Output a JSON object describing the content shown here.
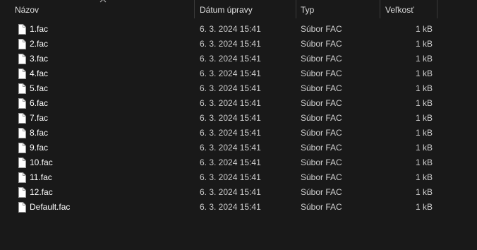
{
  "columns": {
    "name": "Názov",
    "date": "Dátum úpravy",
    "type": "Typ",
    "size": "Veľkosť"
  },
  "sort": {
    "column": "name",
    "icon": "chevron-up-icon"
  },
  "files": [
    {
      "name": "1.fac",
      "date": "6. 3. 2024 15:41",
      "type": "Súbor FAC",
      "size": "1 kB",
      "icon": "file-icon"
    },
    {
      "name": "2.fac",
      "date": "6. 3. 2024 15:41",
      "type": "Súbor FAC",
      "size": "1 kB",
      "icon": "file-icon"
    },
    {
      "name": "3.fac",
      "date": "6. 3. 2024 15:41",
      "type": "Súbor FAC",
      "size": "1 kB",
      "icon": "file-icon"
    },
    {
      "name": "4.fac",
      "date": "6. 3. 2024 15:41",
      "type": "Súbor FAC",
      "size": "1 kB",
      "icon": "file-icon"
    },
    {
      "name": "5.fac",
      "date": "6. 3. 2024 15:41",
      "type": "Súbor FAC",
      "size": "1 kB",
      "icon": "file-icon"
    },
    {
      "name": "6.fac",
      "date": "6. 3. 2024 15:41",
      "type": "Súbor FAC",
      "size": "1 kB",
      "icon": "file-icon"
    },
    {
      "name": "7.fac",
      "date": "6. 3. 2024 15:41",
      "type": "Súbor FAC",
      "size": "1 kB",
      "icon": "file-icon"
    },
    {
      "name": "8.fac",
      "date": "6. 3. 2024 15:41",
      "type": "Súbor FAC",
      "size": "1 kB",
      "icon": "file-icon"
    },
    {
      "name": "9.fac",
      "date": "6. 3. 2024 15:41",
      "type": "Súbor FAC",
      "size": "1 kB",
      "icon": "file-icon"
    },
    {
      "name": "10.fac",
      "date": "6. 3. 2024 15:41",
      "type": "Súbor FAC",
      "size": "1 kB",
      "icon": "file-icon"
    },
    {
      "name": "11.fac",
      "date": "6. 3. 2024 15:41",
      "type": "Súbor FAC",
      "size": "1 kB",
      "icon": "file-icon"
    },
    {
      "name": "12.fac",
      "date": "6. 3. 2024 15:41",
      "type": "Súbor FAC",
      "size": "1 kB",
      "icon": "file-icon"
    },
    {
      "name": "Default.fac",
      "date": "6. 3. 2024 15:41",
      "type": "Súbor FAC",
      "size": "1 kB",
      "icon": "file-icon"
    }
  ],
  "colors": {
    "background": "#191919",
    "text": "#ffffff",
    "secondary_text": "#cfcfcf",
    "divider": "#3a3a3a"
  }
}
